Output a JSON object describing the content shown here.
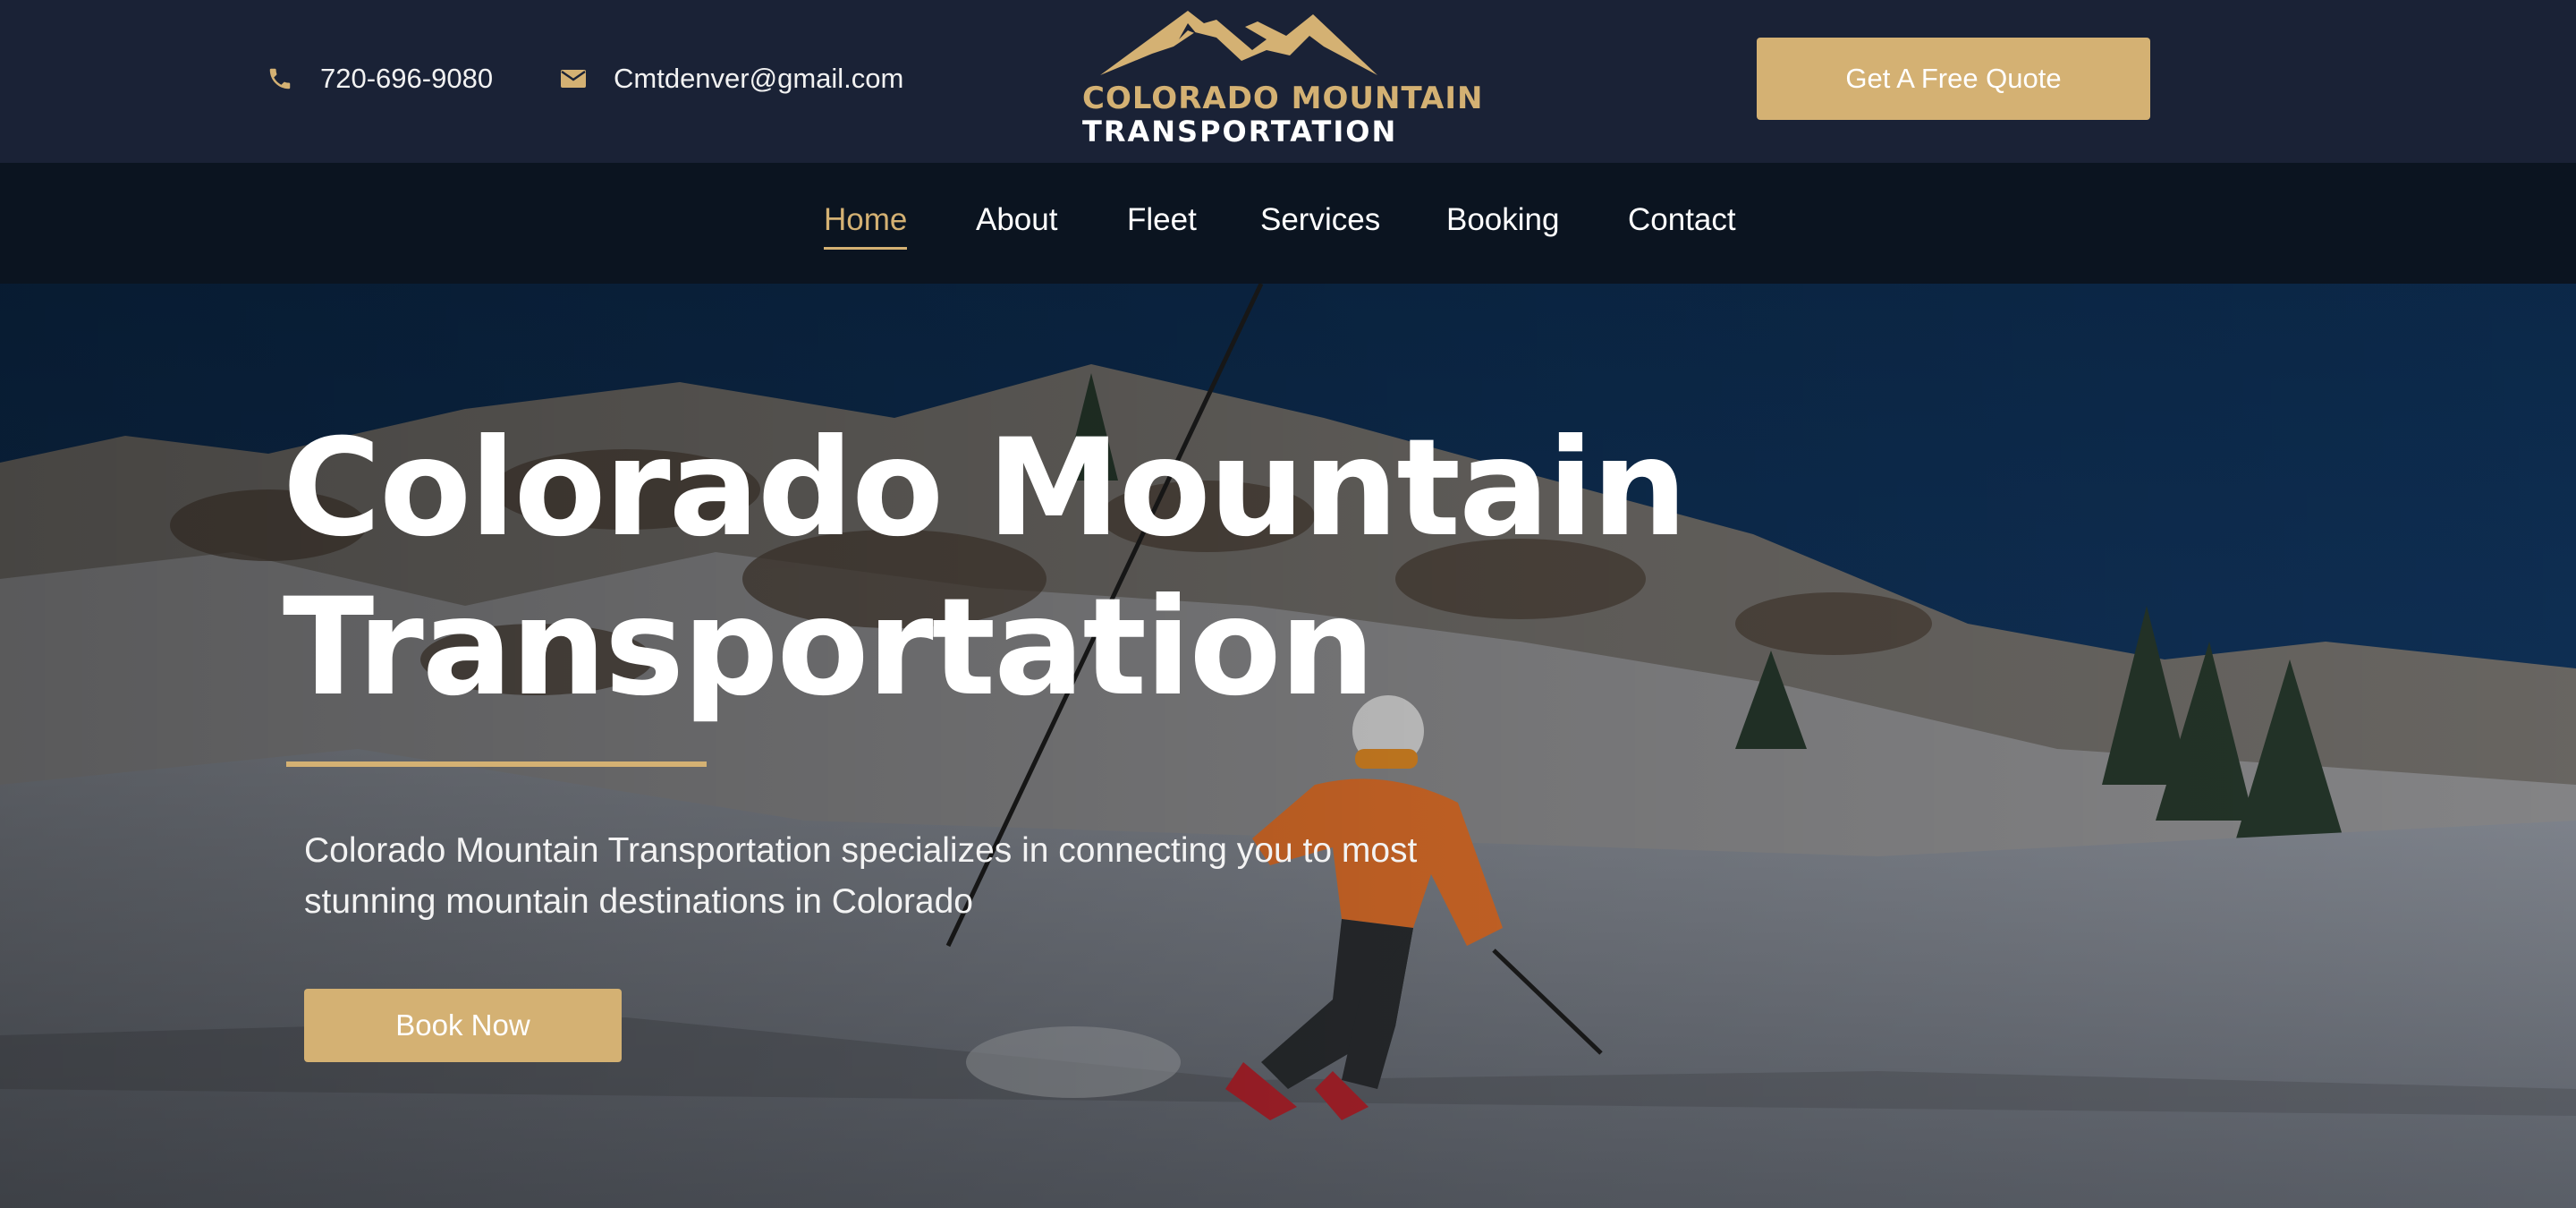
{
  "header": {
    "phone": "720-696-9080",
    "email": "Cmtdenver@gmail.com",
    "logo": {
      "line1": "COLORADO MOUNTAIN",
      "line2": "TRANSPORTATION"
    },
    "cta_label": "Get A Free Quote"
  },
  "nav": {
    "items": [
      {
        "label": "Home",
        "active": true
      },
      {
        "label": "About"
      },
      {
        "label": "Fleet"
      },
      {
        "label": "Services"
      },
      {
        "label": "Booking"
      },
      {
        "label": "Contact"
      }
    ]
  },
  "hero": {
    "title_line1": "Colorado Mountain",
    "title_line2": "Transportation",
    "subtitle_line1": "Colorado Mountain Transportation specializes in connecting you to most",
    "subtitle_line2": "stunning mountain destinations in Colorado",
    "button_label": "Book Now"
  },
  "icons": {
    "phone": "phone-icon",
    "email": "envelope-icon",
    "logo_mark": "mountain-peaks-icon"
  },
  "colors": {
    "accent": "#d4b173",
    "topbar": "#1a2236",
    "nav": "#0b1420",
    "text": "#ffffff"
  }
}
